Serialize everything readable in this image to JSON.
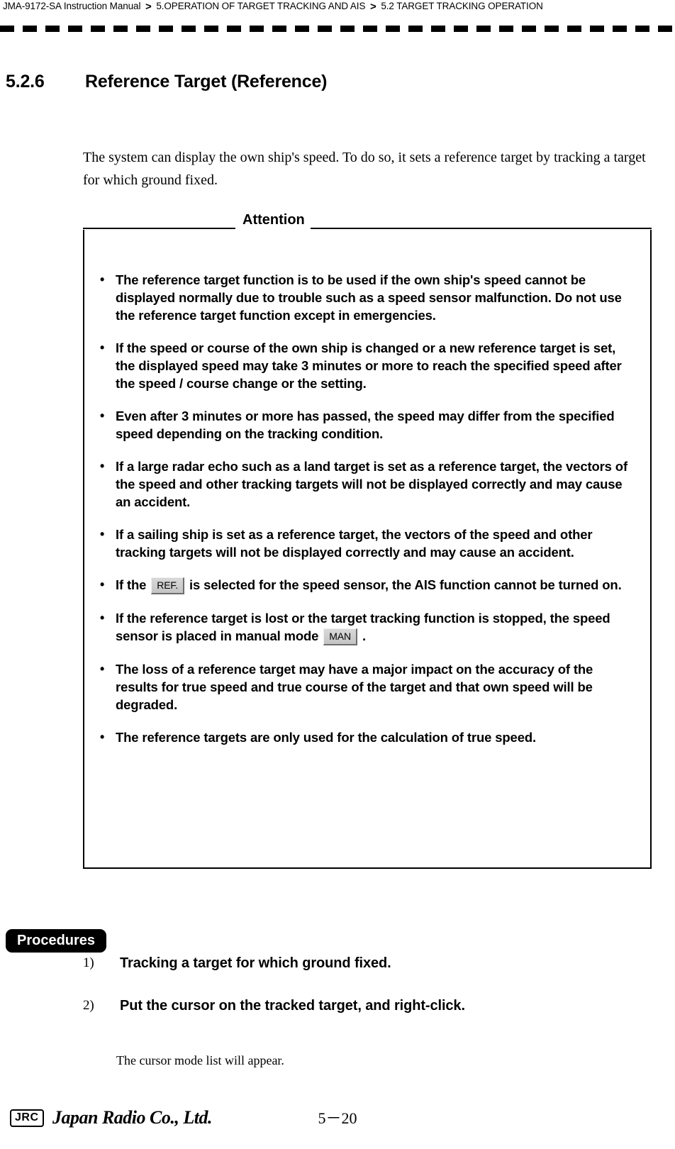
{
  "header": {
    "manual_title": "JMA-9172-SA Instruction Manual",
    "separator": ">",
    "crumb_chapter": "5.OPERATION OF TARGET TRACKING AND AIS",
    "crumb_section": "5.2  TARGET TRACKING OPERATION"
  },
  "section": {
    "number": "5.2.6",
    "title": "Reference Target (Reference)"
  },
  "intro": {
    "paragraph": "The system can display the own ship's speed. To do so, it sets a reference target by tracking a target for which ground fixed."
  },
  "attention": {
    "title": "Attention",
    "bullet_glyph": "•",
    "items": [
      {
        "text": "The reference target function is to be used if the own ship's speed cannot be displayed normally due to trouble such as a speed sensor malfunction. Do not use the reference target function except in emergencies."
      },
      {
        "text": "If the speed or course of the own ship is changed or a new reference target is set, the displayed speed may take 3 minutes or more to reach the specified speed after the speed / course change or the setting."
      },
      {
        "text": "Even after 3 minutes or more has passed, the speed may differ from the specified speed depending on the tracking condition."
      },
      {
        "text": "If a large radar echo such as a land target is set as a reference target, the vectors of the speed and other tracking targets will not be displayed correctly and may cause an accident."
      },
      {
        "text": "If a sailing ship is set as a reference target, the vectors of the speed and other tracking targets will not be displayed correctly and may cause an accident."
      },
      {
        "text_before": "If the ",
        "chip": "REF.",
        "text_after": " is selected for the speed sensor, the AIS function cannot be turned on."
      },
      {
        "text_before": "If the reference target is lost or the target tracking function is stopped, the speed sensor is placed in manual mode ",
        "chip": "MAN",
        "text_after": " ."
      },
      {
        "text": "The loss of a reference target may have a major impact on the accuracy of the results for true speed and true course of the target and that own speed will be degraded."
      },
      {
        "text": "The reference targets are only used for the calculation of true speed."
      }
    ]
  },
  "procedures": {
    "tag_label": "Procedures",
    "steps": [
      {
        "number": "1)",
        "text": "Tracking a target for which ground fixed."
      },
      {
        "number": "2)",
        "text": "Put the cursor on the tracked target, and right-click."
      }
    ],
    "note": "The cursor mode list will appear."
  },
  "footer": {
    "logo_mark": "JRC",
    "company": "Japan Radio Co., Ltd.",
    "page_number": "5－20"
  }
}
